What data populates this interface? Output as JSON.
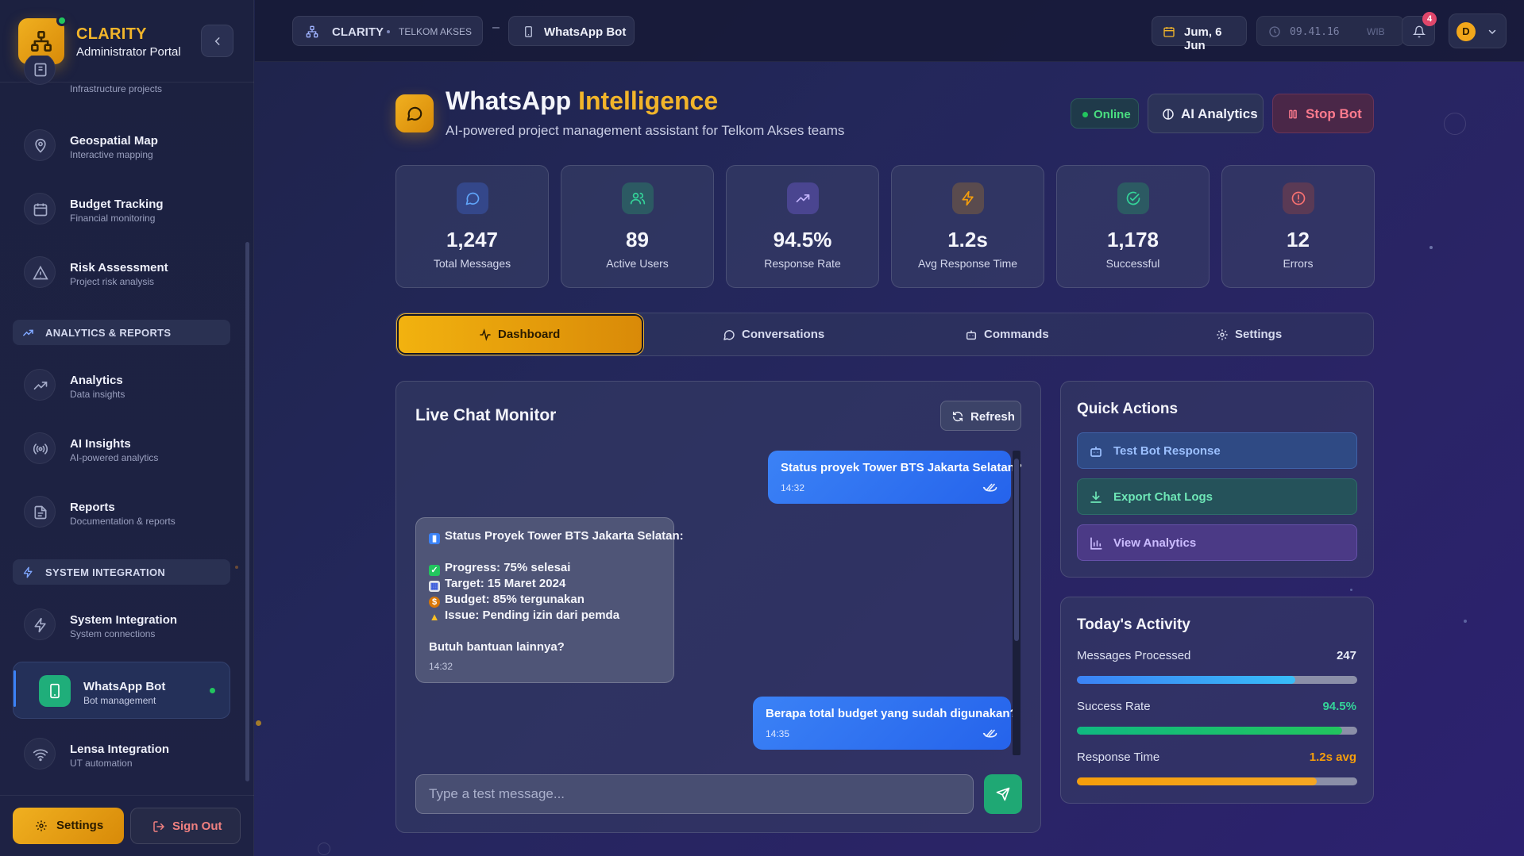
{
  "sidebar": {
    "brand": "CLARITY",
    "brand_sub": "Administrator Portal",
    "items_top": [
      {
        "title": "",
        "sub": "Infrastructure projects",
        "icon": "building-icon"
      },
      {
        "title": "Geospatial Map",
        "sub": "Interactive mapping",
        "icon": "map-pin-icon"
      },
      {
        "title": "Budget Tracking",
        "sub": "Financial monitoring",
        "icon": "calendar-icon"
      },
      {
        "title": "Risk Assessment",
        "sub": "Project risk analysis",
        "icon": "warning-icon"
      }
    ],
    "section_analytics": "ANALYTICS & REPORTS",
    "items_analytics": [
      {
        "title": "Analytics",
        "sub": "Data insights",
        "icon": "trend-up-icon"
      },
      {
        "title": "AI Insights",
        "sub": "AI-powered analytics",
        "icon": "radio-icon"
      },
      {
        "title": "Reports",
        "sub": "Documentation & reports",
        "icon": "file-icon"
      }
    ],
    "section_system": "SYSTEM INTEGRATION",
    "items_system": [
      {
        "title": "System Integration",
        "sub": "System connections",
        "icon": "bolt-icon"
      },
      {
        "title": "WhatsApp Bot",
        "sub": "Bot management",
        "icon": "phone-icon"
      },
      {
        "title": "Lensa Integration",
        "sub": "UT automation",
        "icon": "wifi-icon"
      }
    ],
    "settings_label": "Settings",
    "signout_label": "Sign Out"
  },
  "topbar": {
    "crumb_app": "CLARITY",
    "crumb_org": "TELKOM AKSES",
    "crumb_sep": "–",
    "crumb_page": "WhatsApp Bot",
    "date": "Jum, 6 Jun",
    "time": "09.41.16",
    "timezone": "WIB",
    "notif_count": "4",
    "user_initial": "D"
  },
  "header": {
    "title_plain": "WhatsApp ",
    "title_highlight": "Intelligence",
    "subtitle": "AI-powered project management assistant for Telkom Akses teams",
    "status": "Online",
    "ai_button": "AI Analytics",
    "stop_button": "Stop Bot"
  },
  "stats": [
    {
      "value": "1,247",
      "label": "Total Messages",
      "icon": "message-icon",
      "color": "#60a5fa",
      "bg": "#34478a"
    },
    {
      "value": "89",
      "label": "Active Users",
      "icon": "users-icon",
      "color": "#34d399",
      "bg": "#2c5a63"
    },
    {
      "value": "94.5%",
      "label": "Response Rate",
      "icon": "trend-up-icon",
      "color": "#c4b5fd",
      "bg": "#4a4590"
    },
    {
      "value": "1.2s",
      "label": "Avg Response Time",
      "icon": "bolt-icon",
      "color": "#f59e0b",
      "bg": "#5a4b4e"
    },
    {
      "value": "1,178",
      "label": "Successful",
      "icon": "check-circle-icon",
      "color": "#34d399",
      "bg": "#2c5a63"
    },
    {
      "value": "12",
      "label": "Errors",
      "icon": "alert-circle-icon",
      "color": "#f87171",
      "bg": "#5a3a55"
    }
  ],
  "tabs": [
    {
      "label": "Dashboard",
      "icon": "activity-icon"
    },
    {
      "label": "Conversations",
      "icon": "message-icon"
    },
    {
      "label": "Commands",
      "icon": "bot-icon"
    },
    {
      "label": "Settings",
      "icon": "gear-icon"
    }
  ],
  "chat": {
    "title": "Live Chat Monitor",
    "refresh": "Refresh",
    "messages": [
      {
        "from": "user",
        "text": "Status proyek Tower BTS Jakarta Selatan?",
        "time": "14:32"
      },
      {
        "from": "bot",
        "lines": [
          {
            "emoji": "chart",
            "text": "Status Proyek Tower BTS Jakarta Selatan:"
          },
          {
            "emoji": "check",
            "text": "Progress: 75% selesai"
          },
          {
            "emoji": "calendar",
            "text": "Target: 15 Maret 2024"
          },
          {
            "emoji": "money",
            "text": "Budget: 85% tergunakan"
          },
          {
            "emoji": "warning",
            "text": "Issue: Pending izin dari pemda"
          },
          {
            "emoji": "",
            "text": "Butuh bantuan lainnya?"
          }
        ],
        "time": "14:32"
      },
      {
        "from": "user",
        "text": "Berapa total budget yang sudah digunakan?",
        "time": "14:35"
      }
    ],
    "input_placeholder": "Type a test message..."
  },
  "quick_actions": {
    "title": "Quick Actions",
    "items": [
      {
        "label": "Test Bot Response",
        "icon": "bot-icon"
      },
      {
        "label": "Export Chat Logs",
        "icon": "download-icon"
      },
      {
        "label": "View Analytics",
        "icon": "bar-chart-icon"
      }
    ]
  },
  "activity": {
    "title": "Today's Activity",
    "rows": [
      {
        "label": "Messages Processed",
        "value": "247",
        "fill": 0.78,
        "color": "#e9edf8",
        "bar": "linear-gradient(90deg,#3b82f6,#38bdf8)"
      },
      {
        "label": "Success Rate",
        "value": "94.5%",
        "fill": 0.945,
        "color": "#34d399",
        "bar": "linear-gradient(90deg,#10b981,#22c55e)"
      },
      {
        "label": "Response Time",
        "value": "1.2s avg",
        "fill": 0.855,
        "color": "#f59e0b",
        "bar": "linear-gradient(90deg,#f59e0b,#f5a623)"
      }
    ]
  }
}
